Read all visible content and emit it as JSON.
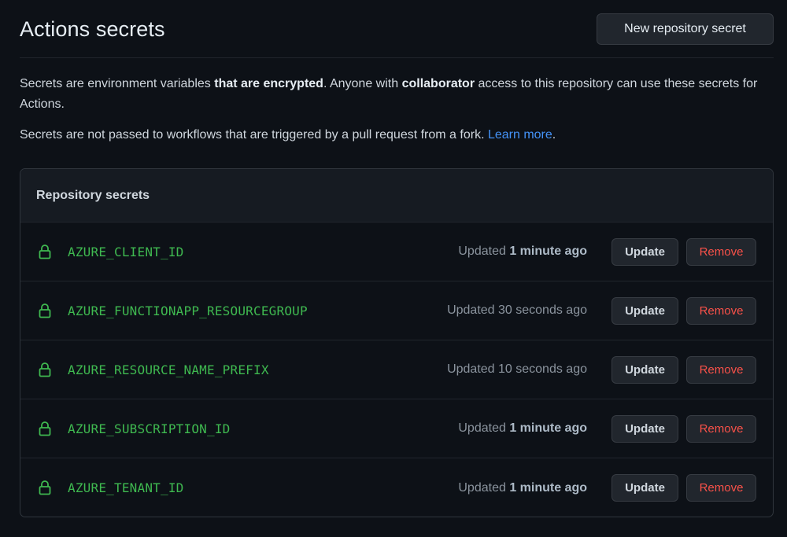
{
  "header": {
    "title": "Actions secrets",
    "new_secret_button": "New repository secret"
  },
  "description": {
    "p1_part1": "Secrets are environment variables ",
    "p1_bold1": "that are encrypted",
    "p1_part2": ". Anyone with ",
    "p1_bold2": "collaborator",
    "p1_part3": " access to this repository can use these secrets for Actions.",
    "p2_text": "Secrets are not passed to workflows that are triggered by a pull request from a fork. ",
    "p2_link": "Learn more",
    "p2_end": "."
  },
  "panel": {
    "title": "Repository secrets",
    "update_label": "Update",
    "remove_label": "Remove",
    "secrets": [
      {
        "name": "AZURE_CLIENT_ID",
        "updated_prefix": "Updated ",
        "updated_value": "1 minute ago",
        "bold": true
      },
      {
        "name": "AZURE_FUNCTIONAPP_RESOURCEGROUP",
        "updated_prefix": "Updated ",
        "updated_value": "30 seconds ago",
        "bold": false
      },
      {
        "name": "AZURE_RESOURCE_NAME_PREFIX",
        "updated_prefix": "Updated ",
        "updated_value": "10 seconds ago",
        "bold": false
      },
      {
        "name": "AZURE_SUBSCRIPTION_ID",
        "updated_prefix": "Updated ",
        "updated_value": "1 minute ago",
        "bold": true
      },
      {
        "name": "AZURE_TENANT_ID",
        "updated_prefix": "Updated ",
        "updated_value": "1 minute ago",
        "bold": true
      }
    ]
  },
  "colors": {
    "background": "#0d1117",
    "secret_name": "#3fb950",
    "remove": "#f85149",
    "link": "#4493f8"
  }
}
